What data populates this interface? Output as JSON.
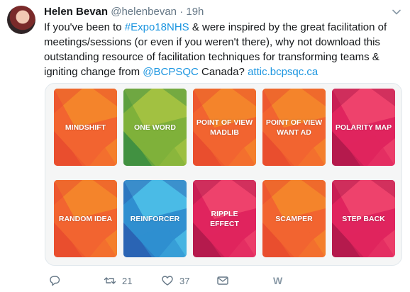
{
  "tweet": {
    "author_name": "Helen Bevan",
    "handle": "@helenbevan",
    "separator": "·",
    "time": "19h",
    "text_1": "If you've been to ",
    "hashtag": "#Expo18NHS",
    "text_2": " & were inspired by the great facilitation of meetings/sessions (or even if you weren't there), why not download this outstanding resource of facilitation techniques for transforming teams & igniting change from ",
    "mention": "@BCPSQC",
    "text_3": " Canada? ",
    "url": "attic.bcpsqc.ca"
  },
  "cards": [
    {
      "label": "MINDSHIFT",
      "base": "#f26430",
      "alt": "#f58a2a",
      "dark": "#e84b2f"
    },
    {
      "label": "ONE WORD",
      "base": "#7fb13a",
      "alt": "#a8c443",
      "dark": "#3b8e43"
    },
    {
      "label": "POINT OF VIEW MADLIB",
      "base": "#f26430",
      "alt": "#f58a2a",
      "dark": "#e84b2f"
    },
    {
      "label": "POINT OF VIEW WANT AD",
      "base": "#f26430",
      "alt": "#f58a2a",
      "dark": "#e84b2f"
    },
    {
      "label": "POLARITY MAP",
      "base": "#e0245e",
      "alt": "#f0486e",
      "dark": "#b01a4b"
    },
    {
      "label": "RANDOM IDEA",
      "base": "#f26430",
      "alt": "#f58a2a",
      "dark": "#e84b2f"
    },
    {
      "label": "REINFORCER",
      "base": "#2f8fd0",
      "alt": "#4fc3ea",
      "dark": "#2a5fb0"
    },
    {
      "label": "RIPPLE EFFECT",
      "base": "#e0245e",
      "alt": "#f0486e",
      "dark": "#b01a4b"
    },
    {
      "label": "SCAMPER",
      "base": "#f26430",
      "alt": "#f58a2a",
      "dark": "#e84b2f"
    },
    {
      "label": "STEP BACK",
      "base": "#e0245e",
      "alt": "#f0486e",
      "dark": "#b01a4b"
    }
  ],
  "actions": {
    "reply_icon": "reply-icon",
    "retweet_count": "21",
    "like_count": "37",
    "dm_icon": "envelope-icon",
    "extension_label": "W"
  },
  "colors": {
    "link": "#1b95e0",
    "muted": "#657786"
  }
}
